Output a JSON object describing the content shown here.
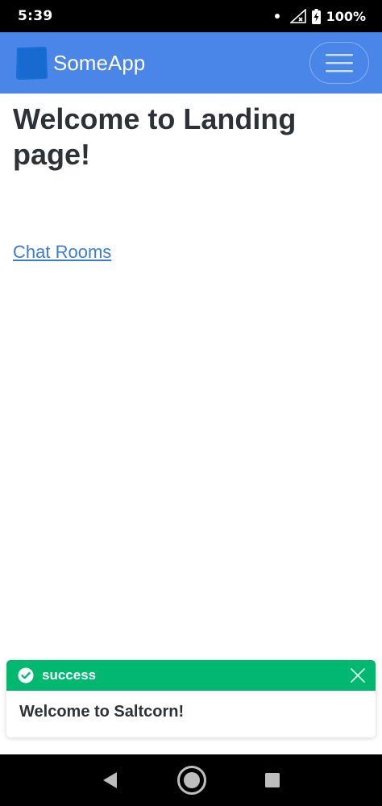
{
  "status_bar": {
    "time": "5:39",
    "battery": "100%",
    "icons": [
      "notification-dot-icon",
      "signal-no-sim-icon",
      "battery-charging-icon"
    ]
  },
  "navbar": {
    "brand_name": "SomeApp",
    "logo_color": "#1a6fd6",
    "background_color": "#4a86e8",
    "menu_icon": "hamburger-menu-icon"
  },
  "main": {
    "title": "Welcome to Landing page!",
    "link_text": "Chat Rooms"
  },
  "toast": {
    "title": "success",
    "message": "Welcome to Saltcorn!",
    "header_color": "#00b870",
    "icons": [
      "check-circle-icon",
      "close-icon"
    ]
  },
  "nav_bar": {
    "icons": [
      "back-icon",
      "home-icon",
      "recents-icon"
    ]
  }
}
